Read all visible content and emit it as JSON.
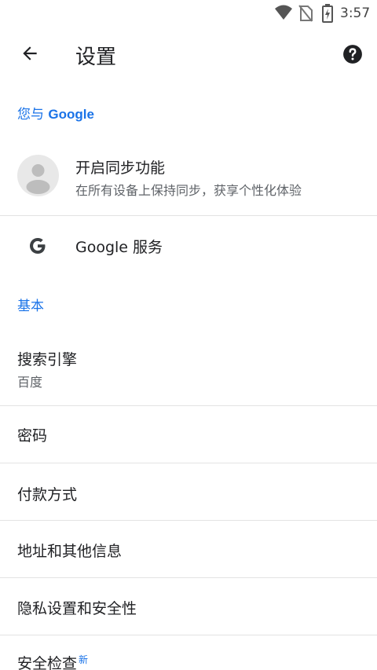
{
  "status_bar": {
    "time": "3:57",
    "icons": [
      "wifi-icon",
      "no-sim-icon",
      "battery-charging-icon"
    ]
  },
  "app_bar": {
    "title": "设置",
    "back_icon": "arrow-back-icon",
    "help_icon": "help-icon"
  },
  "sections": {
    "you_and_google": {
      "prefix": "您与 ",
      "brand": "Google"
    },
    "basic": {
      "label": "基本"
    }
  },
  "sync": {
    "title": "开启同步功能",
    "subtitle": "在所有设备上保持同步，获享个性化体验"
  },
  "google_services": {
    "label": "Google 服务"
  },
  "items": [
    {
      "title": "搜索引擎",
      "subtitle": "百度"
    },
    {
      "title": "密码"
    },
    {
      "title": "付款方式"
    },
    {
      "title": "地址和其他信息"
    },
    {
      "title": "隐私设置和安全性"
    },
    {
      "title": "安全检查",
      "badge": "新"
    }
  ],
  "colors": {
    "accent": "#1a73e8",
    "text_primary": "#202124",
    "text_secondary": "#5f6368",
    "divider": "#e3e3e3"
  }
}
